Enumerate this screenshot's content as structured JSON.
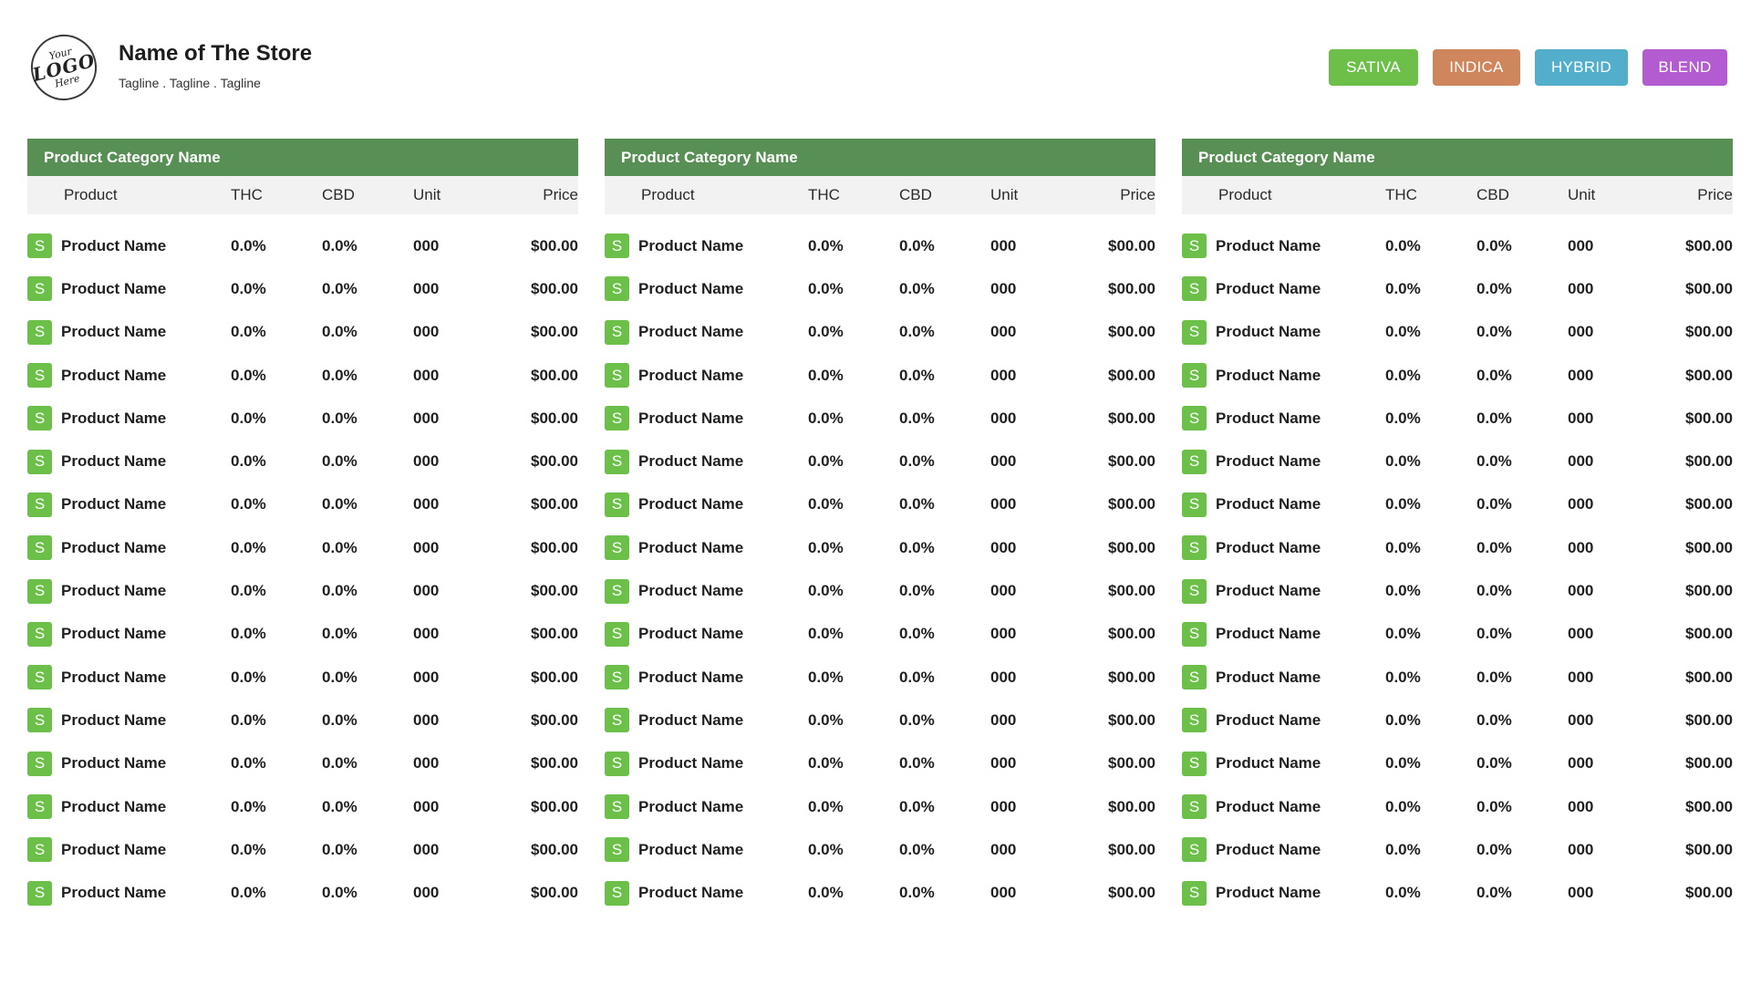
{
  "header": {
    "logo_text": {
      "line1": "Your",
      "line2": "LOGO",
      "line3": "Here"
    },
    "store_name": "Name of The Store",
    "tagline": "Tagline . Tagline . Tagline"
  },
  "legend": [
    {
      "label": "SATIVA",
      "color": "#6cc04a"
    },
    {
      "label": "INDICA",
      "color": "#d0865c"
    },
    {
      "label": "HYBRID",
      "color": "#52aecb"
    },
    {
      "label": "BLEND",
      "color": "#b35cd1"
    }
  ],
  "colors": {
    "category_header": "#578f54",
    "sativa_badge": "#6cc04a",
    "column_header_bg": "#f2f2f2"
  },
  "columns": [
    "Product",
    "THC",
    "CBD",
    "Unit",
    "Price"
  ],
  "panels": [
    {
      "category": "Product Category Name",
      "rows": [
        {
          "badge": "S",
          "name": "Product Name",
          "thc": "0.0%",
          "cbd": "0.0%",
          "unit": "000",
          "price": "$00.00"
        },
        {
          "badge": "S",
          "name": "Product Name",
          "thc": "0.0%",
          "cbd": "0.0%",
          "unit": "000",
          "price": "$00.00"
        },
        {
          "badge": "S",
          "name": "Product Name",
          "thc": "0.0%",
          "cbd": "0.0%",
          "unit": "000",
          "price": "$00.00"
        },
        {
          "badge": "S",
          "name": "Product Name",
          "thc": "0.0%",
          "cbd": "0.0%",
          "unit": "000",
          "price": "$00.00"
        },
        {
          "badge": "S",
          "name": "Product Name",
          "thc": "0.0%",
          "cbd": "0.0%",
          "unit": "000",
          "price": "$00.00"
        },
        {
          "badge": "S",
          "name": "Product Name",
          "thc": "0.0%",
          "cbd": "0.0%",
          "unit": "000",
          "price": "$00.00"
        },
        {
          "badge": "S",
          "name": "Product Name",
          "thc": "0.0%",
          "cbd": "0.0%",
          "unit": "000",
          "price": "$00.00"
        },
        {
          "badge": "S",
          "name": "Product Name",
          "thc": "0.0%",
          "cbd": "0.0%",
          "unit": "000",
          "price": "$00.00"
        },
        {
          "badge": "S",
          "name": "Product Name",
          "thc": "0.0%",
          "cbd": "0.0%",
          "unit": "000",
          "price": "$00.00"
        },
        {
          "badge": "S",
          "name": "Product Name",
          "thc": "0.0%",
          "cbd": "0.0%",
          "unit": "000",
          "price": "$00.00"
        },
        {
          "badge": "S",
          "name": "Product Name",
          "thc": "0.0%",
          "cbd": "0.0%",
          "unit": "000",
          "price": "$00.00"
        },
        {
          "badge": "S",
          "name": "Product Name",
          "thc": "0.0%",
          "cbd": "0.0%",
          "unit": "000",
          "price": "$00.00"
        },
        {
          "badge": "S",
          "name": "Product Name",
          "thc": "0.0%",
          "cbd": "0.0%",
          "unit": "000",
          "price": "$00.00"
        },
        {
          "badge": "S",
          "name": "Product Name",
          "thc": "0.0%",
          "cbd": "0.0%",
          "unit": "000",
          "price": "$00.00"
        },
        {
          "badge": "S",
          "name": "Product Name",
          "thc": "0.0%",
          "cbd": "0.0%",
          "unit": "000",
          "price": "$00.00"
        },
        {
          "badge": "S",
          "name": "Product Name",
          "thc": "0.0%",
          "cbd": "0.0%",
          "unit": "000",
          "price": "$00.00"
        }
      ]
    },
    {
      "category": "Product Category Name",
      "rows": [
        {
          "badge": "S",
          "name": "Product Name",
          "thc": "0.0%",
          "cbd": "0.0%",
          "unit": "000",
          "price": "$00.00"
        },
        {
          "badge": "S",
          "name": "Product Name",
          "thc": "0.0%",
          "cbd": "0.0%",
          "unit": "000",
          "price": "$00.00"
        },
        {
          "badge": "S",
          "name": "Product Name",
          "thc": "0.0%",
          "cbd": "0.0%",
          "unit": "000",
          "price": "$00.00"
        },
        {
          "badge": "S",
          "name": "Product Name",
          "thc": "0.0%",
          "cbd": "0.0%",
          "unit": "000",
          "price": "$00.00"
        },
        {
          "badge": "S",
          "name": "Product Name",
          "thc": "0.0%",
          "cbd": "0.0%",
          "unit": "000",
          "price": "$00.00"
        },
        {
          "badge": "S",
          "name": "Product Name",
          "thc": "0.0%",
          "cbd": "0.0%",
          "unit": "000",
          "price": "$00.00"
        },
        {
          "badge": "S",
          "name": "Product Name",
          "thc": "0.0%",
          "cbd": "0.0%",
          "unit": "000",
          "price": "$00.00"
        },
        {
          "badge": "S",
          "name": "Product Name",
          "thc": "0.0%",
          "cbd": "0.0%",
          "unit": "000",
          "price": "$00.00"
        },
        {
          "badge": "S",
          "name": "Product Name",
          "thc": "0.0%",
          "cbd": "0.0%",
          "unit": "000",
          "price": "$00.00"
        },
        {
          "badge": "S",
          "name": "Product Name",
          "thc": "0.0%",
          "cbd": "0.0%",
          "unit": "000",
          "price": "$00.00"
        },
        {
          "badge": "S",
          "name": "Product Name",
          "thc": "0.0%",
          "cbd": "0.0%",
          "unit": "000",
          "price": "$00.00"
        },
        {
          "badge": "S",
          "name": "Product Name",
          "thc": "0.0%",
          "cbd": "0.0%",
          "unit": "000",
          "price": "$00.00"
        },
        {
          "badge": "S",
          "name": "Product Name",
          "thc": "0.0%",
          "cbd": "0.0%",
          "unit": "000",
          "price": "$00.00"
        },
        {
          "badge": "S",
          "name": "Product Name",
          "thc": "0.0%",
          "cbd": "0.0%",
          "unit": "000",
          "price": "$00.00"
        },
        {
          "badge": "S",
          "name": "Product Name",
          "thc": "0.0%",
          "cbd": "0.0%",
          "unit": "000",
          "price": "$00.00"
        },
        {
          "badge": "S",
          "name": "Product Name",
          "thc": "0.0%",
          "cbd": "0.0%",
          "unit": "000",
          "price": "$00.00"
        }
      ]
    },
    {
      "category": "Product Category Name",
      "rows": [
        {
          "badge": "S",
          "name": "Product Name",
          "thc": "0.0%",
          "cbd": "0.0%",
          "unit": "000",
          "price": "$00.00"
        },
        {
          "badge": "S",
          "name": "Product Name",
          "thc": "0.0%",
          "cbd": "0.0%",
          "unit": "000",
          "price": "$00.00"
        },
        {
          "badge": "S",
          "name": "Product Name",
          "thc": "0.0%",
          "cbd": "0.0%",
          "unit": "000",
          "price": "$00.00"
        },
        {
          "badge": "S",
          "name": "Product Name",
          "thc": "0.0%",
          "cbd": "0.0%",
          "unit": "000",
          "price": "$00.00"
        },
        {
          "badge": "S",
          "name": "Product Name",
          "thc": "0.0%",
          "cbd": "0.0%",
          "unit": "000",
          "price": "$00.00"
        },
        {
          "badge": "S",
          "name": "Product Name",
          "thc": "0.0%",
          "cbd": "0.0%",
          "unit": "000",
          "price": "$00.00"
        },
        {
          "badge": "S",
          "name": "Product Name",
          "thc": "0.0%",
          "cbd": "0.0%",
          "unit": "000",
          "price": "$00.00"
        },
        {
          "badge": "S",
          "name": "Product Name",
          "thc": "0.0%",
          "cbd": "0.0%",
          "unit": "000",
          "price": "$00.00"
        },
        {
          "badge": "S",
          "name": "Product Name",
          "thc": "0.0%",
          "cbd": "0.0%",
          "unit": "000",
          "price": "$00.00"
        },
        {
          "badge": "S",
          "name": "Product Name",
          "thc": "0.0%",
          "cbd": "0.0%",
          "unit": "000",
          "price": "$00.00"
        },
        {
          "badge": "S",
          "name": "Product Name",
          "thc": "0.0%",
          "cbd": "0.0%",
          "unit": "000",
          "price": "$00.00"
        },
        {
          "badge": "S",
          "name": "Product Name",
          "thc": "0.0%",
          "cbd": "0.0%",
          "unit": "000",
          "price": "$00.00"
        },
        {
          "badge": "S",
          "name": "Product Name",
          "thc": "0.0%",
          "cbd": "0.0%",
          "unit": "000",
          "price": "$00.00"
        },
        {
          "badge": "S",
          "name": "Product Name",
          "thc": "0.0%",
          "cbd": "0.0%",
          "unit": "000",
          "price": "$00.00"
        },
        {
          "badge": "S",
          "name": "Product Name",
          "thc": "0.0%",
          "cbd": "0.0%",
          "unit": "000",
          "price": "$00.00"
        },
        {
          "badge": "S",
          "name": "Product Name",
          "thc": "0.0%",
          "cbd": "0.0%",
          "unit": "000",
          "price": "$00.00"
        }
      ]
    }
  ]
}
